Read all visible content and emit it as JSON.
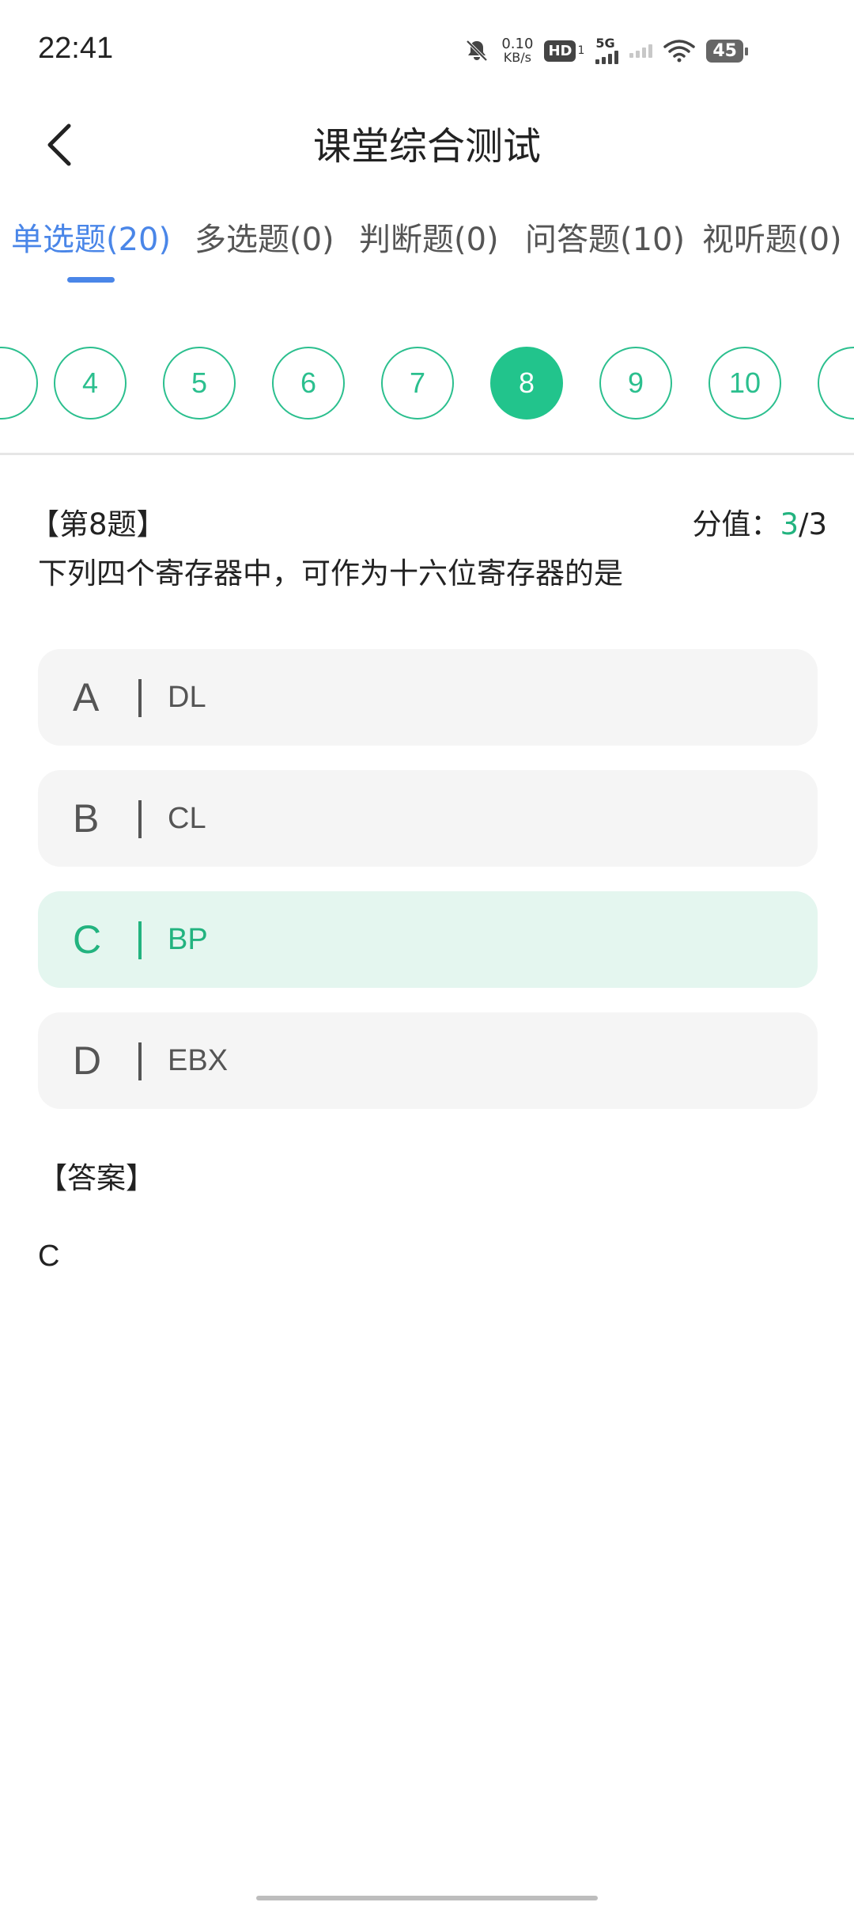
{
  "status_bar": {
    "time": "22:41",
    "net_speed_value": "0.10",
    "net_speed_unit": "KB/s",
    "hd_label": "HD",
    "sim_number": "1",
    "network_type": "5G",
    "battery": "45"
  },
  "header": {
    "title": "课堂综合测试",
    "back_icon": "chevron-left-icon"
  },
  "tabs": [
    {
      "label": "单选题(20)",
      "active": true
    },
    {
      "label": "多选题(0)",
      "active": false
    },
    {
      "label": "判断题(0)",
      "active": false
    },
    {
      "label": "问答题(10)",
      "active": false
    },
    {
      "label": "视听题(0)",
      "active": false
    }
  ],
  "question_numbers": [
    "4",
    "5",
    "6",
    "7",
    "8",
    "9",
    "10"
  ],
  "current_question": "8",
  "question": {
    "number_label": "【第8题】",
    "score_label": "分值：",
    "score_obtained": "3",
    "score_total": "/3",
    "text": "下列四个寄存器中，可作为十六位寄存器的是"
  },
  "options": [
    {
      "letter": "A",
      "text": "DL",
      "selected": false
    },
    {
      "letter": "B",
      "text": "CL",
      "selected": false
    },
    {
      "letter": "C",
      "text": "BP",
      "selected": true
    },
    {
      "letter": "D",
      "text": "EBX",
      "selected": false
    }
  ],
  "answer": {
    "label": "【答案】",
    "value": "C"
  },
  "colors": {
    "accent_green": "#22c48c",
    "tab_blue": "#4a86e8",
    "selected_bg": "#e4f6ef"
  }
}
